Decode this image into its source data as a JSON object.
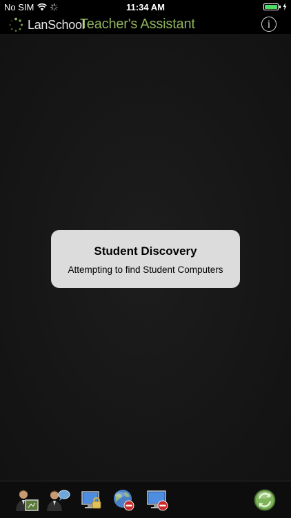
{
  "status_bar": {
    "carrier": "No SIM",
    "time": "11:34 AM",
    "battery_level": 1.0
  },
  "header": {
    "brand": "LanSchool",
    "title": "Teacher's Assistant",
    "info_icon": "info-icon",
    "title_color": "#8fb35c"
  },
  "alert": {
    "title": "Student Discovery",
    "message": "Attempting to find Student Computers"
  },
  "toolbar": {
    "icons": [
      "teacher-screen-icon",
      "teacher-chat-icon",
      "lock-screen-icon",
      "block-web-icon",
      "blank-screen-icon",
      "refresh-icon"
    ]
  },
  "colors": {
    "background": "#171717",
    "alert_background": "#dcdcdc",
    "battery": "#4cd964"
  }
}
